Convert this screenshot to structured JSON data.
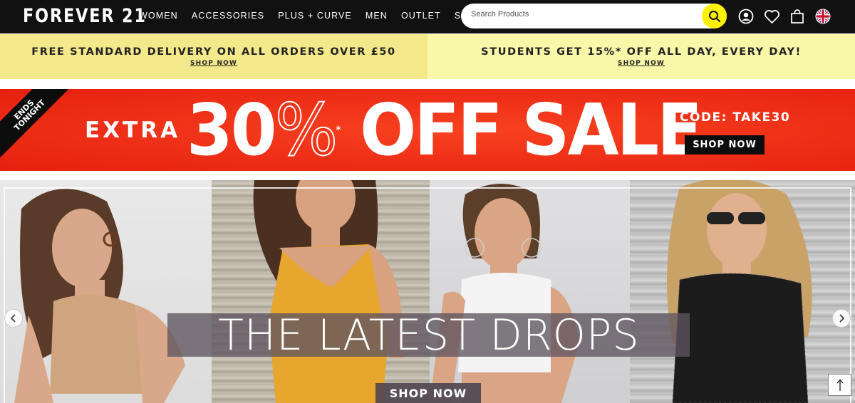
{
  "header": {
    "logo": "FOREVER 21",
    "nav": [
      "WOMEN",
      "ACCESSORIES",
      "PLUS + CURVE",
      "MEN",
      "OUTLET",
      "SALE"
    ],
    "search_placeholder": "Search Products",
    "icons": [
      "search-icon",
      "account-icon",
      "wishlist-heart-icon",
      "shopping-bag-icon",
      "uk-flag-icon"
    ]
  },
  "promos": [
    {
      "title": "FREE STANDARD DELIVERY ON ALL ORDERS OVER £50",
      "link": "SHOP NOW"
    },
    {
      "title": "STUDENTS GET 15%* OFF ALL DAY, EVERY DAY!",
      "link": "SHOP NOW"
    }
  ],
  "sale": {
    "ribbon": "ENDS TONIGHT",
    "extra": "EXTRA",
    "amount": "30",
    "percent": "%",
    "asterisk": "*",
    "headline": "OFF SALE",
    "code": "CODE: TAKE30",
    "button": "SHOP NOW"
  },
  "hero": {
    "title": "THE LATEST DROPS",
    "button": "SHOP NOW"
  },
  "colors": {
    "header_bg": "#111111",
    "search_accent": "#fff200",
    "promo_left_bg": "#f4e98a",
    "promo_right_bg": "#f9f7a8",
    "sale_red": "#ee2f17"
  }
}
